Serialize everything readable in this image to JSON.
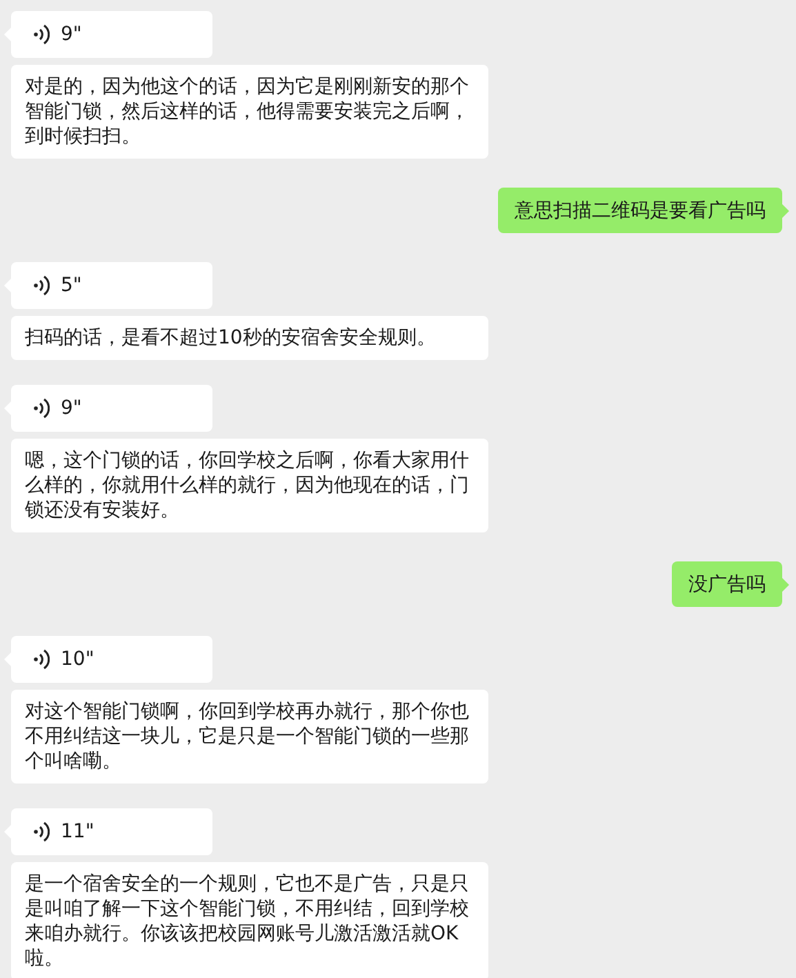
{
  "messages": [
    {
      "kind": "voice",
      "duration": "9\"",
      "transcript": "对是的，因为他这个的话，因为它是刚刚新安的那个智能门锁，然后这样的话，他得需要安装完之后啊，到时候扫扫。"
    },
    {
      "kind": "text",
      "text": "意思扫描二维码是要看广告吗"
    },
    {
      "kind": "voice",
      "duration": "5\"",
      "transcript": "扫码的话，是看不超过10秒的安宿舍安全规则。"
    },
    {
      "kind": "voice",
      "duration": "9\"",
      "transcript": "嗯，这个门锁的话，你回学校之后啊，你看大家用什么样的，你就用什么样的就行，因为他现在的话，门锁还没有安装好。"
    },
    {
      "kind": "text",
      "text": "没广告吗"
    },
    {
      "kind": "voice",
      "duration": "10\"",
      "transcript": "对这个智能门锁啊，你回到学校再办就行，那个你也不用纠结这一块儿，它是只是一个智能门锁的一些那个叫啥嘞。"
    },
    {
      "kind": "voice",
      "duration": "11\"",
      "transcript": "是一个宿舍安全的一个规则，它也不是广告，只是只是叫咱了解一下这个智能门锁，不用纠结，回到学校来咱办就行。你该该把校园网账号儿激活激活就OK啦。"
    }
  ]
}
